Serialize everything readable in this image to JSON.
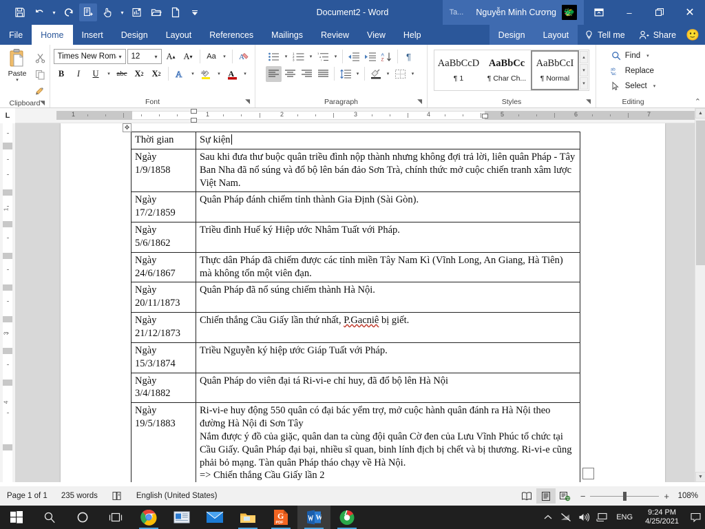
{
  "titlebar": {
    "document_title": "Document2  -  Word",
    "quick_access": [
      {
        "name": "save",
        "icon": "save-icon"
      },
      {
        "name": "undo",
        "icon": "undo-icon"
      },
      {
        "name": "redo",
        "icon": "redo-icon"
      },
      {
        "name": "repeat-typing",
        "icon": "repeat-icon"
      },
      {
        "name": "touch-mode",
        "icon": "touch-mode-icon"
      },
      {
        "name": "chart",
        "icon": "chart-edit-icon"
      },
      {
        "name": "open",
        "icon": "folder-open-icon"
      },
      {
        "name": "new",
        "icon": "new-document-icon"
      },
      {
        "name": "customize",
        "icon": "chevron-down-icon"
      }
    ],
    "context_tab_chip": "Ta...",
    "account_name": "Nguyễn Minh Cương",
    "ribbon_display_options": "ribbon-display-icon",
    "minimize": "–",
    "restore": "❐",
    "close": "✕"
  },
  "ribbon": {
    "tabs": [
      {
        "label": "File",
        "active": false
      },
      {
        "label": "Home",
        "active": true
      },
      {
        "label": "Insert",
        "active": false
      },
      {
        "label": "Design",
        "active": false
      },
      {
        "label": "Layout",
        "active": false
      },
      {
        "label": "References",
        "active": false
      },
      {
        "label": "Mailings",
        "active": false
      },
      {
        "label": "Review",
        "active": false
      },
      {
        "label": "View",
        "active": false
      },
      {
        "label": "Help",
        "active": false
      }
    ],
    "contextual_tabs": [
      {
        "label": "Design"
      },
      {
        "label": "Layout"
      }
    ],
    "tell_me": "Tell me",
    "share": "Share",
    "groups": {
      "clipboard": {
        "label": "Clipboard",
        "paste": "Paste",
        "cut": "cut-icon",
        "copy": "copy-icon",
        "format_painter": "format-painter-icon"
      },
      "font": {
        "label": "Font",
        "font_name": "Times New Roma",
        "font_size": "12",
        "grow_font": "A",
        "shrink_font": "A",
        "change_case": "Aa",
        "clear_formatting": "clear-formatting-icon",
        "bold": "B",
        "italic": "I",
        "underline": "U",
        "strikethrough": "abc",
        "subscript": "X",
        "superscript": "X",
        "text_effects": "A",
        "highlight": "highlight-icon",
        "font_color": "A"
      },
      "paragraph": {
        "label": "Paragraph",
        "bullets": "bullets-icon",
        "numbering": "numbering-icon",
        "multilevel_list": "multilevel-list-icon",
        "decrease_indent": "decrease-indent-icon",
        "increase_indent": "increase-indent-icon",
        "sort": "sort-icon",
        "show_marks": "¶",
        "align_left": "align-left-icon",
        "align_center": "align-center-icon",
        "align_right": "align-right-icon",
        "justify": "justify-icon",
        "line_spacing": "line-spacing-icon",
        "shading": "shading-icon",
        "borders": "borders-icon"
      },
      "styles": {
        "label": "Styles",
        "items": [
          {
            "preview": "AaBbCcD",
            "name": "¶ 1",
            "bold": false,
            "selected": false
          },
          {
            "preview": "AaBbCc",
            "name": "¶ Char Ch...",
            "bold": true,
            "selected": false
          },
          {
            "preview": "AaBbCcI",
            "name": "¶ Normal",
            "bold": false,
            "selected": true
          }
        ]
      },
      "editing": {
        "label": "Editing",
        "find": "Find",
        "replace": "Replace",
        "select": "Select"
      }
    }
  },
  "ruler": {
    "tab_stop_selector": "L",
    "horizontal_numbers": [
      "1",
      "1",
      "2",
      "3",
      "4",
      "5",
      "6",
      "7"
    ],
    "vertical_numbers": [
      "1",
      "3",
      "4"
    ]
  },
  "document": {
    "table": {
      "headers": [
        "Thời gian",
        "Sự kiện"
      ],
      "rows": [
        {
          "time": "Ngày 1/9/1858",
          "event": "Sau khi đưa thư buộc quân triều đình nộp thành nhưng không đợi trả lời, liên quân Pháp - Tây Ban Nha đã nổ súng và đổ bộ lên bán đảo Sơn Trà, chính thức mở cuộc chiến tranh xâm lược Việt Nam."
        },
        {
          "time": "Ngày 17/2/1859",
          "event": "Quân Pháp đánh chiếm tỉnh thành Gia Định (Sài Gòn)."
        },
        {
          "time": "Ngày 5/6/1862",
          "event": "Triều đình Huế ký Hiệp ước Nhâm Tuất với Pháp."
        },
        {
          "time": "Ngày 24/6/1867",
          "event": "Thực dân Pháp đã chiếm được các tỉnh miền Tây Nam Kì (Vĩnh Long, An Giang, Hà Tiên) mà không tốn một viên đạn."
        },
        {
          "time": "Ngày 20/11/1873",
          "event": "Quân Pháp đã nổ súng chiếm thành Hà Nội."
        },
        {
          "time": "Ngày 21/12/1873",
          "event_before": "Chiến thắng Cầu Giấy lần thứ nhất, ",
          "event_misspelled": "P.Gacniê",
          "event_after": " bị giết."
        },
        {
          "time": "Ngày 15/3/1874",
          "event": "Triều Nguyễn ký hiệp ước Giáp Tuất với Pháp."
        },
        {
          "time": "Ngày 3/4/1882",
          "event": "Quân Pháp do viên đại tá Ri-vi-e chỉ huy, đã đổ bộ lên Hà Nội"
        },
        {
          "time": "Ngày 19/5/1883",
          "event_lines": [
            "Ri-vi-e huy động 550 quân có đại bác yểm trợ, mở cuộc hành quân đánh ra Hà Nội theo đường Hà Nội đi Sơn Tây",
            "Nắm được ý đồ của giặc, quân dan ta cùng đội quân Cờ đen của Lưu Vĩnh Phúc tổ chức tại Cầu Giấy. Quân Pháp đại bại, nhiều sĩ quan, binh lính địch bị chết và bị thương. Ri-vi-e cũng phải bỏ mạng. Tàn quân Pháp tháo chạy về Hà Nội.",
            "=> Chiến thắng Cầu Giấy lần 2"
          ]
        }
      ]
    }
  },
  "statusbar": {
    "page": "Page 1 of 1",
    "words": "235 words",
    "proofing_icon": "proofing-errors-icon",
    "language": "English (United States)",
    "view_read": "read-mode-icon",
    "view_print": "print-layout-icon",
    "view_web": "web-layout-icon",
    "zoom_out": "−",
    "zoom_in": "+",
    "zoom_level": "108%"
  },
  "taskbar": {
    "start": "start-icon",
    "search": "search-icon",
    "cortana": "cortana-icon",
    "task_view": "task-view-icon",
    "apps": [
      {
        "name": "chrome",
        "icon": "chrome-icon"
      },
      {
        "name": "news",
        "icon": "news-icon"
      },
      {
        "name": "mail",
        "icon": "mail-icon"
      },
      {
        "name": "file-explorer",
        "icon": "file-explorer-icon"
      },
      {
        "name": "pdf-reader",
        "icon": "pdf-icon",
        "badge": "PDF"
      },
      {
        "name": "word",
        "icon": "word-icon"
      },
      {
        "name": "unikey",
        "icon": "unikey-icon"
      }
    ],
    "tray": {
      "show_hidden": "⌃",
      "network": "network-off-icon",
      "volume": "volume-icon",
      "display": "display-icon",
      "language": "ENG",
      "time": "9:24 PM",
      "date": "4/25/2021",
      "action_center": "action-center-icon"
    }
  },
  "colors": {
    "word_blue": "#2b579a",
    "word_blue_light": "#3f6bb0",
    "ribbon_bg": "#ffffff",
    "status_bg": "#f1f1f1",
    "taskbar_bg": "#1f1f1f",
    "page_bg": "#d8d8d8"
  }
}
